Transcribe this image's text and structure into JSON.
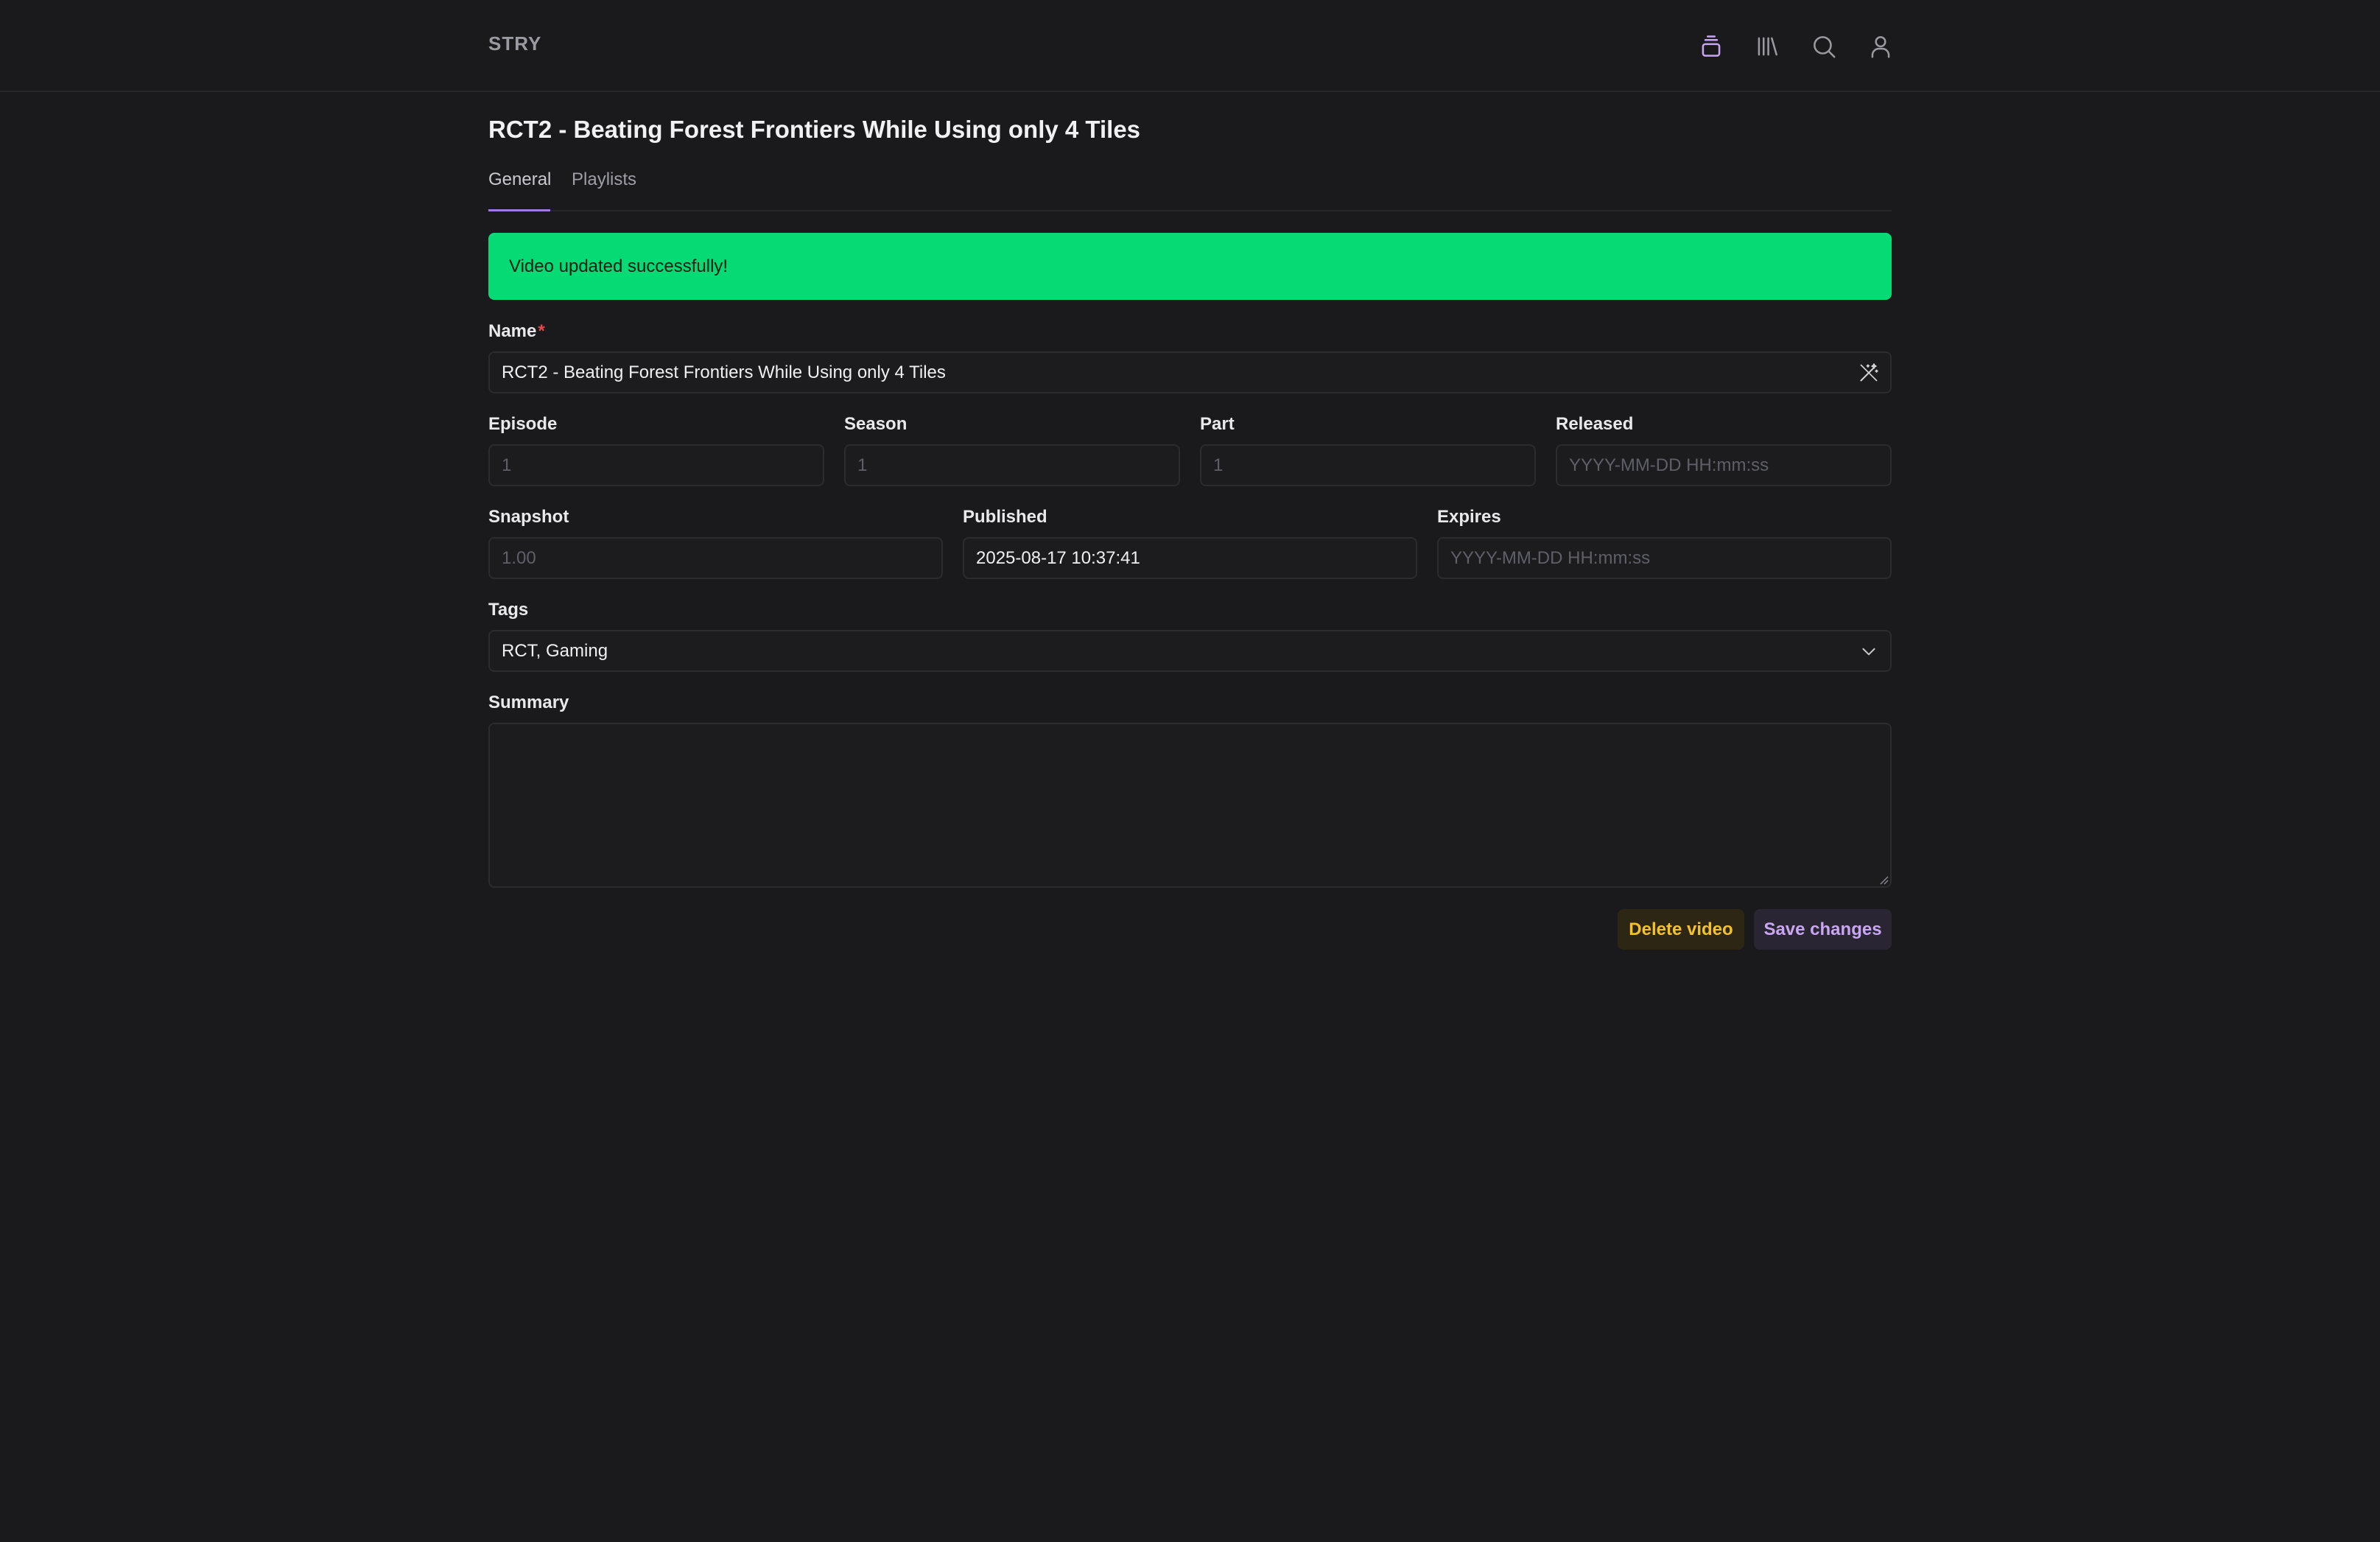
{
  "app": {
    "brand": "STRY"
  },
  "nav": {
    "icons": [
      {
        "name": "stack-icon",
        "color": "#c9a6f2"
      },
      {
        "name": "library-icon",
        "color": "#9a9aa1"
      },
      {
        "name": "search-icon",
        "color": "#9a9aa1"
      },
      {
        "name": "user-icon",
        "color": "#9a9aa1"
      }
    ]
  },
  "page": {
    "title": "RCT2 - Beating Forest Frontiers While Using only 4 Tiles"
  },
  "tabs": [
    {
      "label": "General",
      "active": true
    },
    {
      "label": "Playlists",
      "active": false
    }
  ],
  "alert": {
    "message": "Video updated successfully!",
    "color": "#05da74"
  },
  "form": {
    "name": {
      "label": "Name",
      "required_mark": "*",
      "value": "RCT2 - Beating Forest Frontiers While Using only 4 Tiles",
      "icon": "magic-wand-icon"
    },
    "episode": {
      "label": "Episode",
      "placeholder": "1"
    },
    "season": {
      "label": "Season",
      "placeholder": "1"
    },
    "part": {
      "label": "Part",
      "placeholder": "1"
    },
    "released": {
      "label": "Released",
      "placeholder": "YYYY-MM-DD HH:mm:ss"
    },
    "snapshot": {
      "label": "Snapshot",
      "placeholder": "1.00"
    },
    "published": {
      "label": "Published",
      "value": "2025-08-17 10:37:41"
    },
    "expires": {
      "label": "Expires",
      "placeholder": "YYYY-MM-DD HH:mm:ss"
    },
    "tags": {
      "label": "Tags",
      "value": "RCT, Gaming",
      "icon": "chevron-down-icon"
    },
    "summary": {
      "label": "Summary",
      "value": ""
    }
  },
  "actions": {
    "delete_label": "Delete video",
    "save_label": "Save changes",
    "delete_color": "#f3c12a",
    "save_color": "#c9a6f2"
  }
}
